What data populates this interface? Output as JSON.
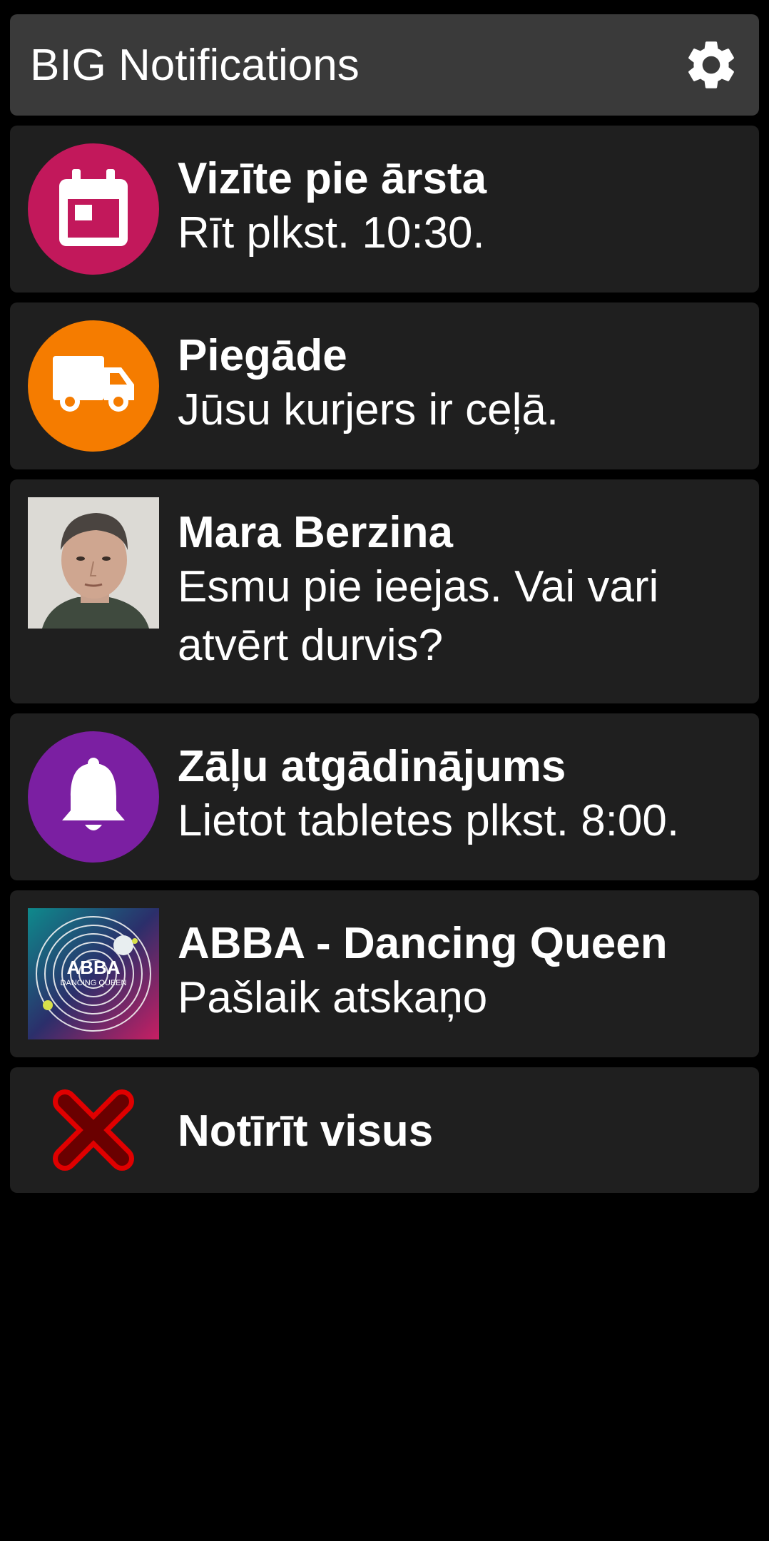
{
  "header": {
    "title": "BIG Notifications",
    "settings_icon": "gear-icon"
  },
  "notifications": [
    {
      "title": "Vizīte pie ārsta",
      "body": "Rīt plkst. 10:30.",
      "icon": "calendar-icon",
      "color": "#c2185b"
    },
    {
      "title": "Piegāde",
      "body": "Jūsu kurjers ir ceļā.",
      "icon": "truck-icon",
      "color": "#f57c00"
    },
    {
      "title": "Mara Berzina",
      "body": "Esmu pie ieejas. Vai vari atvērt durvis?",
      "icon": "avatar"
    },
    {
      "title": "Zāļu atgādinājums",
      "body": "Lietot tabletes plkst. 8:00.",
      "icon": "bell-icon",
      "color": "#7b1fa2"
    },
    {
      "title": "ABBA - Dancing Queen",
      "body": "Pašlaik atskaņo",
      "icon": "album-art",
      "album_text": "ABBA",
      "album_subtext": "DANCING QUEEN"
    }
  ],
  "clear_all": {
    "label": "Notīrīt visus",
    "icon": "close-icon",
    "color": "#e00000"
  }
}
